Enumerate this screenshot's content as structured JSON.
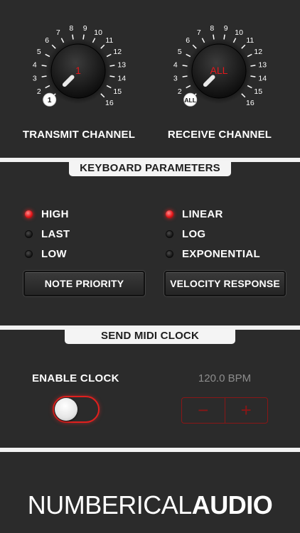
{
  "transmit": {
    "label": "TRANSMIT CHANNEL",
    "value": "1",
    "marker": "1",
    "ticks": [
      "1",
      "2",
      "3",
      "4",
      "5",
      "6",
      "7",
      "8",
      "9",
      "10",
      "11",
      "12",
      "13",
      "14",
      "15",
      "16"
    ]
  },
  "receive": {
    "label": "RECEIVE CHANNEL",
    "value": "ALL",
    "marker": "ALL",
    "ticks": [
      "1",
      "2",
      "3",
      "4",
      "5",
      "6",
      "7",
      "8",
      "9",
      "10",
      "11",
      "12",
      "13",
      "14",
      "15",
      "16"
    ]
  },
  "keyboard": {
    "title": "KEYBOARD PARAMETERS",
    "note_priority": {
      "options": [
        {
          "label": "HIGH",
          "on": true
        },
        {
          "label": "LAST",
          "on": false
        },
        {
          "label": "LOW",
          "on": false
        }
      ],
      "button": "NOTE PRIORITY"
    },
    "velocity": {
      "options": [
        {
          "label": "LINEAR",
          "on": true
        },
        {
          "label": "LOG",
          "on": false
        },
        {
          "label": "EXPONENTIAL",
          "on": false
        }
      ],
      "button": "VELOCITY RESPONSE"
    }
  },
  "clock": {
    "title": "SEND MIDI CLOCK",
    "enable_label": "ENABLE CLOCK",
    "enabled": false,
    "bpm": "120.0 BPM",
    "minus": "−",
    "plus": "+"
  },
  "brand": {
    "light": "NUMBERICAL",
    "bold": "AUDIO"
  },
  "colors": {
    "accent": "#e4181c",
    "dim_accent": "#8a1616",
    "background": "#2b2b2b",
    "rule": "#f2f2f2"
  }
}
